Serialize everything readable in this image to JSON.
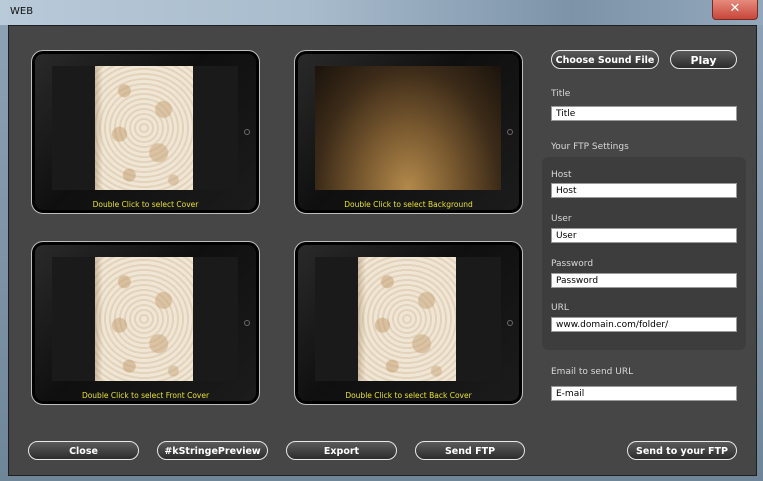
{
  "window": {
    "title": "WEB",
    "close_glyph": "✕"
  },
  "tablets": {
    "cover": {
      "caption": "Double Click to select Cover"
    },
    "background": {
      "caption": "Double Click to select Background"
    },
    "front_cover": {
      "caption": "Double Click to select Front Cover"
    },
    "back_cover": {
      "caption": "Double Click to select Back Cover"
    }
  },
  "sound": {
    "choose_label": "Choose Sound File",
    "play_label": "Play"
  },
  "title_field": {
    "label": "Title",
    "value": "Title"
  },
  "ftp": {
    "section_label": "Your FTP Settings",
    "host": {
      "label": "Host",
      "value": "Host"
    },
    "user": {
      "label": "User",
      "value": "User"
    },
    "password": {
      "label": "Password",
      "value": "Password"
    },
    "url": {
      "label": "URL",
      "value": "www.domain.com/folder/"
    }
  },
  "email": {
    "label": "Email to send URL",
    "value": "E-mail"
  },
  "footer": {
    "close_label": "Close",
    "preview_label": "#kStringePreview",
    "export_label": "Export",
    "send_ftp_label": "Send FTP",
    "send_to_your_ftp_label": "Send to your FTP"
  },
  "icons": {
    "close": "close-icon"
  }
}
